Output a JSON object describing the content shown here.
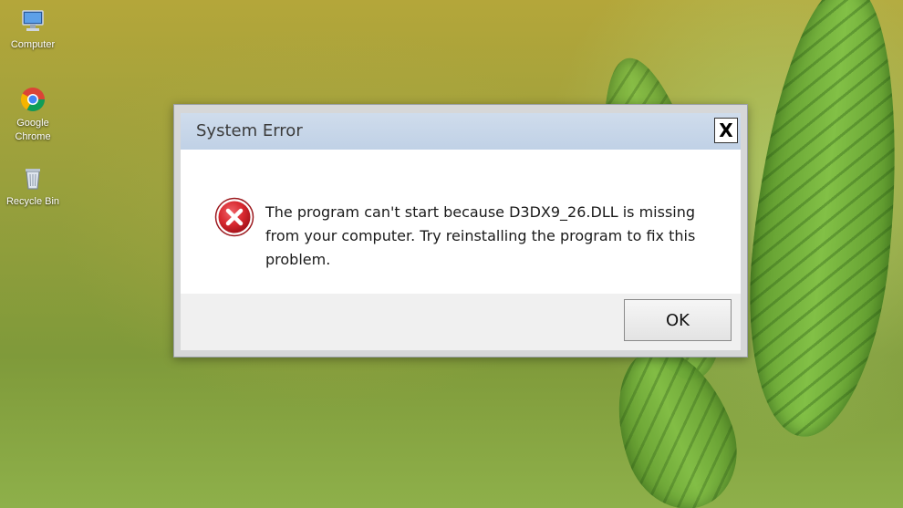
{
  "desktop": {
    "icons": [
      {
        "label": "Computer",
        "icon": "computer-icon"
      },
      {
        "label": "Google Chrome",
        "icon": "chrome-icon"
      },
      {
        "label": "Recycle Bin",
        "icon": "recycle-bin-icon"
      }
    ]
  },
  "dialog": {
    "title": "System Error",
    "close_label": "X",
    "icon": "error-icon",
    "message": "The program can't start because D3DX9_26.DLL is missing from your computer. Try reinstalling the program to fix this problem.",
    "ok_label": "OK"
  },
  "colors": {
    "error_red": "#d7282f",
    "titlebar": "#c6d6ea"
  }
}
